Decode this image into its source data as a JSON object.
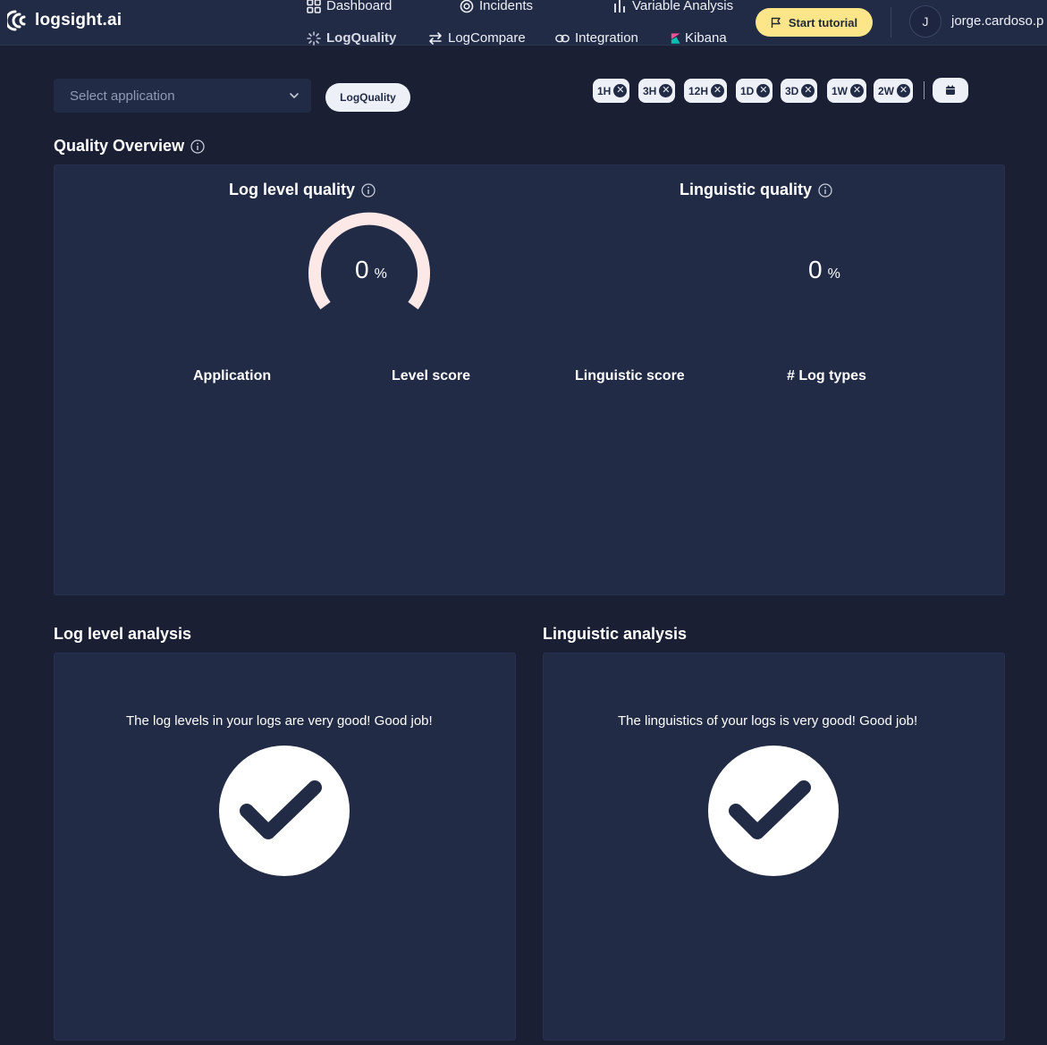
{
  "header": {
    "logo_text": "logsight.ai",
    "nav": [
      {
        "label": "Dashboard",
        "icon": "dashboard-grid-icon"
      },
      {
        "label": "Incidents",
        "icon": "target-icon"
      },
      {
        "label": "Variable Analysis",
        "icon": "bar-chart-icon"
      },
      {
        "label": "LogQuality",
        "icon": "loading-spinner-icon",
        "active": true
      },
      {
        "label": "LogCompare",
        "icon": "swap-arrows-icon"
      },
      {
        "label": "Integration",
        "icon": "link-icon"
      },
      {
        "label": "Kibana",
        "icon": "kibana-logo-icon"
      }
    ],
    "tutorial_label": "Start tutorial",
    "avatar_initial": "J",
    "username": "jorge.cardoso.p"
  },
  "filters": {
    "select_placeholder": "Select application",
    "tag_label": "LogQuality",
    "time_ranges": [
      "1H",
      "3H",
      "12H",
      "1D",
      "3D",
      "1W",
      "2W"
    ]
  },
  "quality_overview": {
    "title": "Quality Overview",
    "log_level": {
      "title": "Log level quality",
      "value": "0",
      "unit": "%"
    },
    "linguistic": {
      "title": "Linguistic quality",
      "value": "0",
      "unit": "%"
    },
    "columns": [
      "Application",
      "Level score",
      "Linguistic score",
      "# Log types"
    ]
  },
  "log_level_analysis": {
    "title": "Log level analysis",
    "message": "The log levels in your logs are very good! Good job!"
  },
  "linguistic_analysis": {
    "title": "Linguistic analysis",
    "message": "The linguistics of your logs is very good! Good job!"
  },
  "colors": {
    "background": "#1a1f33",
    "card": "#222b45",
    "gauge_track": "#fde8e8",
    "tutorial_button": "#fde68a"
  }
}
